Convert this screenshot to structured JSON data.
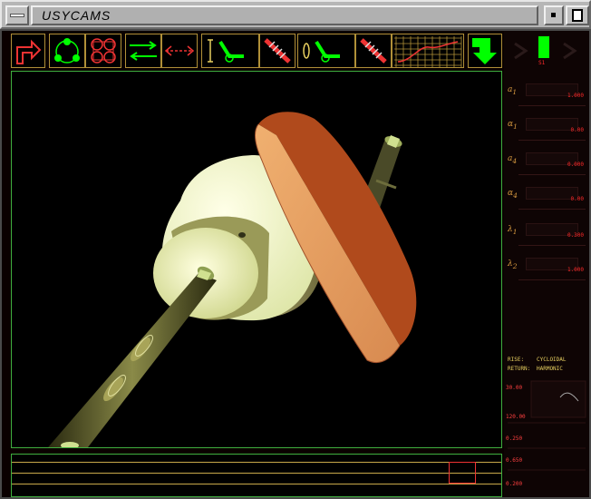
{
  "window": {
    "title": "USYCAMS"
  },
  "toolbar": {
    "tools": [
      {
        "name": "exit-arrow-tool"
      },
      {
        "name": "cam-profile-tool"
      },
      {
        "name": "four-circles-tool"
      },
      {
        "name": "direction-arrows-tool"
      },
      {
        "name": "dashed-arrows-tool"
      },
      {
        "name": "linear-follower-tool"
      },
      {
        "name": "oscillating-follower-tool"
      },
      {
        "name": "spring-follower-tool"
      },
      {
        "name": "grid-chart-tool"
      },
      {
        "name": "down-arrow-tool"
      }
    ],
    "indicator_label": "S1"
  },
  "params": [
    {
      "symbol": "a",
      "sub": "1",
      "value": "1.000"
    },
    {
      "symbol": "α",
      "sub": "1",
      "value": "0.00"
    },
    {
      "symbol": "a",
      "sub": "4",
      "value": "0.000"
    },
    {
      "symbol": "α",
      "sub": "4",
      "value": "0.00"
    },
    {
      "symbol": "λ",
      "sub": "1",
      "value": "0.300"
    },
    {
      "symbol": "λ",
      "sub": "2",
      "value": "1.000"
    }
  ],
  "motion": {
    "rise_label": "RISE:",
    "rise_value": "CYCLOIDAL",
    "return_label": "RETURN:",
    "return_value": "HARMONIC"
  },
  "graph_labels": [
    "30.00",
    "120.00",
    "0.250",
    "0.650",
    "0.200"
  ],
  "colors": {
    "accent_green": "#00ff00",
    "frame_green": "#3faf3f",
    "tool_border": "#b09038",
    "value_red": "#ff2a2a"
  }
}
